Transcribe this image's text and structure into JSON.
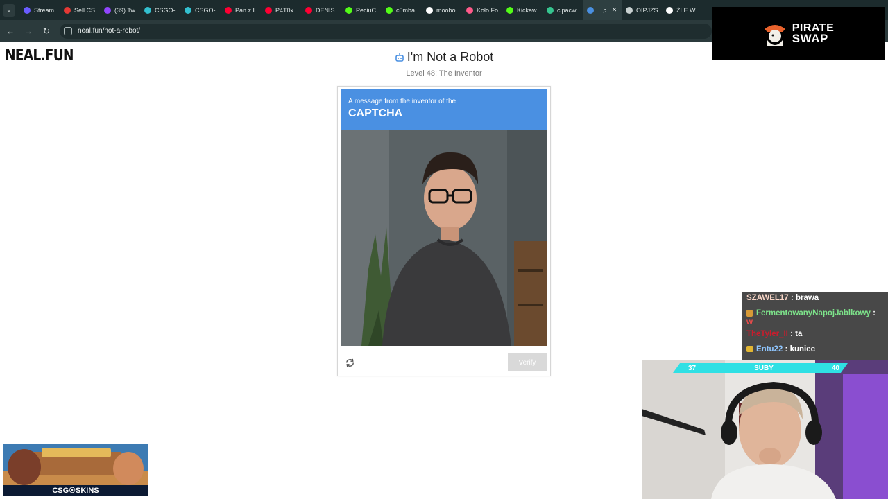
{
  "browser": {
    "tabs": [
      {
        "label": "Stream",
        "color": "#6a5cff"
      },
      {
        "label": "Sell CS",
        "color": "#e53935"
      },
      {
        "label": "(39) Tw",
        "color": "#9146ff"
      },
      {
        "label": "CSGO-",
        "color": "#33c0d0"
      },
      {
        "label": "CSGO-",
        "color": "#33c0d0"
      },
      {
        "label": "Pan z L",
        "color": "#ff0033"
      },
      {
        "label": "P4T0x",
        "color": "#ff0033"
      },
      {
        "label": "DENIS",
        "color": "#ff0033"
      },
      {
        "label": "PeciuC",
        "color": "#53fc18"
      },
      {
        "label": "c0mba",
        "color": "#53fc18"
      },
      {
        "label": "moobo",
        "color": "#ffffff"
      },
      {
        "label": "Koło Fo",
        "color": "#ff5a8a"
      },
      {
        "label": "Kickaw",
        "color": "#53fc18"
      },
      {
        "label": "cipacw",
        "color": "#36c58f"
      },
      {
        "label": "",
        "color": "#4a90e2",
        "active": true
      },
      {
        "label": "OIPJZS",
        "color": "#c8d0d0"
      },
      {
        "label": "ŻLE W",
        "color": "#ffffff"
      }
    ],
    "url": "neal.fun/not-a-robot/"
  },
  "page": {
    "logo": "NEAL.FUN",
    "title": "I'm Not a Robot",
    "level": "Level 48: The Inventor"
  },
  "captcha": {
    "header_small": "A message from the inventor of the",
    "header_big": "CAPTCHA",
    "verify_label": "Verify"
  },
  "overlays": {
    "sponsor_line1": "PIRATE",
    "sponsor_line2": "SWAP",
    "chat": [
      {
        "user": "SZAWEL17",
        "text": "brawa"
      },
      {
        "user": "FermentowanyNapojJablkowy",
        "text": "",
        "tail": "w"
      },
      {
        "user": "TheTyler_II",
        "text": "ta"
      },
      {
        "user": "Entu22",
        "text": "kuniec"
      }
    ],
    "subs_left": "37",
    "subs_label": "SUBY",
    "subs_right": "40",
    "promo_label": "CSG☉SKINS"
  },
  "colors": {
    "accent": "#4a90e2",
    "verify_disabled": "#d9d9d9"
  }
}
